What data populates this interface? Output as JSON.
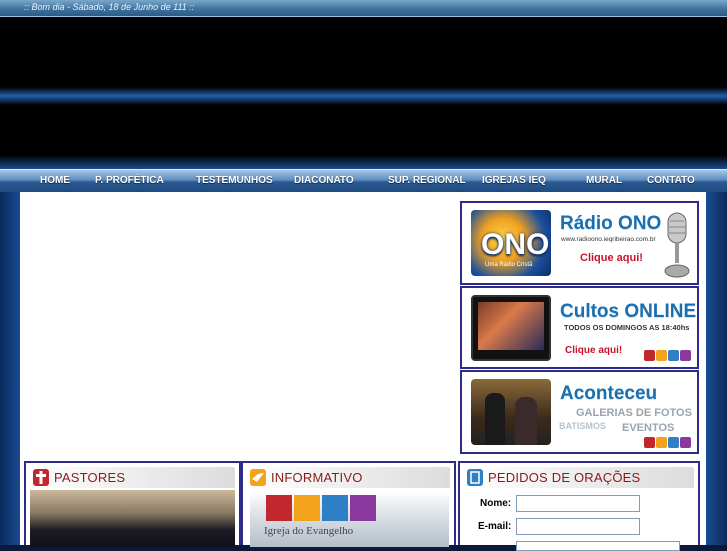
{
  "greeting": ":: Bom dia - Sábado, 18 de Junho de 111 ::",
  "nav": [
    {
      "label": "HOME"
    },
    {
      "label": "P. PROFÉTICA"
    },
    {
      "label": "TESTEMUNHOS"
    },
    {
      "label": "DIACONATO"
    },
    {
      "label": "SUP. REGIONAL"
    },
    {
      "label": "IGREJAS IEQ"
    },
    {
      "label": "MURAL"
    },
    {
      "label": "CONTATO"
    }
  ],
  "promos": {
    "radio": {
      "title": "Rádio ONO",
      "url": "www.radioono.ieqribeirao.com.br",
      "cta": "Clique aqui!",
      "logo_text": "ONO",
      "logo_small": "Uma Rádio Cristã"
    },
    "cultos": {
      "title": "Cultos ONLINE",
      "sub": "TODOS OS DOMINGOS AS 18:40hs",
      "cta": "Clique aqui!"
    },
    "aconteceu": {
      "title": "Aconteceu",
      "line1": "GALERIAS DE FOTOS",
      "line2": "BATISMOS",
      "line3": "EVENTOS"
    }
  },
  "boxes": {
    "pastores": {
      "title": "PASTORES"
    },
    "informativo": {
      "title": "INFORMATIVO",
      "banner_text": "Igreja do Evangelho"
    },
    "pedidos": {
      "title": "PEDIDOS DE ORAÇÕES",
      "fields": [
        {
          "label": "Nome:",
          "value": ""
        },
        {
          "label": "E-mail:",
          "value": ""
        }
      ]
    }
  },
  "colors": {
    "nav_text": "#ffffff",
    "promo_title": "#1a6fb0",
    "cta_red": "#c8122a",
    "box_border": "#2d2a8a",
    "box_title": "#8a1a1a"
  }
}
